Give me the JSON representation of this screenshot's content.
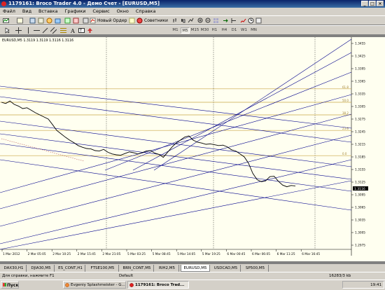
{
  "window": {
    "title": "1179161: Broco Trader 4.0 - Демо Счет - [EURUSD,M5]"
  },
  "menu": [
    "Файл",
    "Вид",
    "Вставка",
    "Графики",
    "Сервис",
    "Окно",
    "Справка"
  ],
  "toolbar": {
    "new_order": "Новый Ордер",
    "advisors": "Советники"
  },
  "timeframes": [
    "M1",
    "M5",
    "M15",
    "M30",
    "H1",
    "H4",
    "D1",
    "W1",
    "MN"
  ],
  "active_timeframe": "M5",
  "chart_header": "EURUSD,M5 1.3119 1.3119 1.3116 1.3116",
  "price_labels": [
    "1.3455",
    "1.3425",
    "1.3395",
    "1.3365",
    "1.3335",
    "1.3305",
    "1.3275",
    "1.3245",
    "1.3215",
    "1.3185",
    "1.3155",
    "1.3125",
    "1.3095",
    "1.3065",
    "1.3035",
    "1.3005",
    "1.2975"
  ],
  "current_price": "1.3116",
  "fib_levels": [
    "61.8",
    "50.0",
    "38.2",
    "23.6",
    "0.0"
  ],
  "time_labels": [
    "1 Mar 2012",
    "2 Mar 05:05",
    "2 Mar 10:25",
    "2 Mar 15:45",
    "2 Mar 21:05",
    "5 Mar 03:25",
    "5 Mar 08:45",
    "5 Mar 14:05",
    "5 Mar 19:25",
    "6 Mar 00:45",
    "6 Mar 06:05",
    "6 Mar 11:25",
    "6 Mar 16:45"
  ],
  "chart_data": {
    "type": "line",
    "symbol": "EURUSD",
    "timeframe": "M5",
    "ylim": [
      1.2965,
      1.347
    ],
    "y": [
      1.3315,
      1.3312,
      1.3318,
      1.331,
      1.3306,
      1.33,
      1.3302,
      1.3296,
      1.329,
      1.3285,
      1.328,
      1.3275,
      1.3262,
      1.3248,
      1.324,
      1.3232,
      1.3225,
      1.3219,
      1.3212,
      1.3208,
      1.3205,
      1.3204,
      1.32,
      1.3199,
      1.3203,
      1.3196,
      1.3192,
      1.319,
      1.3189,
      1.3193,
      1.3197,
      1.3195,
      1.3192,
      1.3195,
      1.3199,
      1.32,
      1.3194,
      1.3191,
      1.3184,
      1.3196,
      1.3208,
      1.3218,
      1.3225,
      1.3232,
      1.3235,
      1.3225,
      1.322,
      1.3218,
      1.3215,
      1.3216,
      1.3214,
      1.3212,
      1.3213,
      1.3209,
      1.3202,
      1.3199,
      1.3192,
      1.3185,
      1.317,
      1.3146,
      1.3131,
      1.3126,
      1.3128,
      1.3138,
      1.3139,
      1.3127,
      1.3118,
      1.3114,
      1.3117,
      1.3116
    ],
    "fib_levels": [
      {
        "label": "61.8",
        "value": 1.3347
      },
      {
        "label": "50.0",
        "value": 1.3315
      },
      {
        "label": "38.2",
        "value": 1.3285
      },
      {
        "label": "23.6",
        "value": 1.3248
      },
      {
        "label": "0.0",
        "value": 1.3188
      }
    ]
  },
  "tabs": [
    "DAX30,H1",
    "DJIA30,M5",
    "ES_CONT,H1",
    "FTSE100,M5",
    "BRN_CONT,M5",
    "RIH2,M5",
    "EURUSD,M5",
    "USDCAD,M5",
    "SP500,M5"
  ],
  "active_tab": "EURUSD,M5",
  "status": {
    "help": "Для справки, нажмите F1",
    "profile": "Default",
    "traffic": "16283/3 kb"
  },
  "taskbar": {
    "start": "Пуск",
    "tasks": [
      "Evgeniy Splashmeister - G...",
      "1179161: Broco Trad..."
    ],
    "clock": "19:41"
  },
  "colors": {
    "bg": "#fffff0",
    "trend": "#00008b",
    "fib": "#c8a646",
    "price": "#000000",
    "grid": "#000000"
  }
}
